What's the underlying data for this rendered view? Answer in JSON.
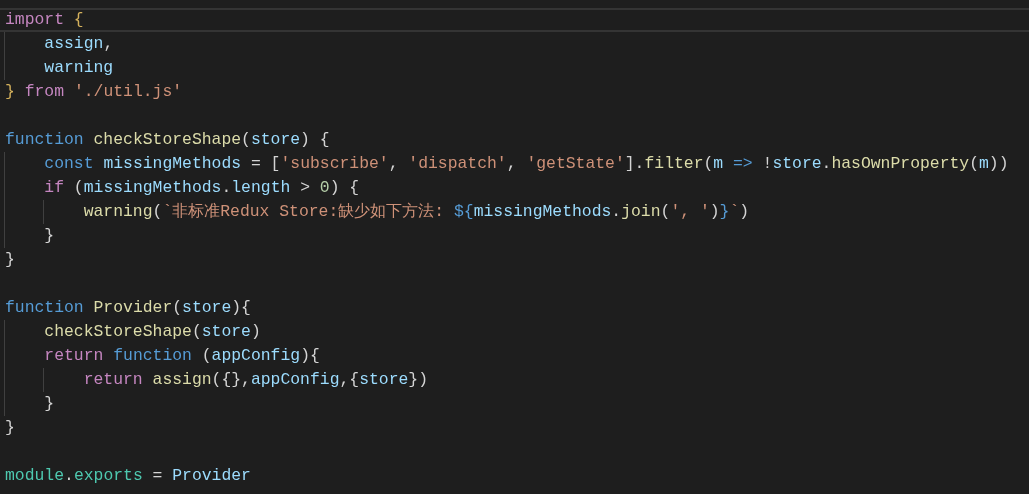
{
  "editor": {
    "lines": [
      {
        "kind": "code",
        "current": true,
        "tokens": [
          {
            "text": "import ",
            "kind": "keyword"
          },
          {
            "text": "{",
            "kind": "brace"
          }
        ]
      },
      {
        "kind": "code",
        "current": false,
        "tokens": [
          {
            "text": "    assign",
            "kind": "variable"
          },
          {
            "text": ",",
            "kind": "plain"
          }
        ]
      },
      {
        "kind": "code",
        "current": false,
        "tokens": [
          {
            "text": "    warning",
            "kind": "variable"
          }
        ]
      },
      {
        "kind": "code",
        "current": false,
        "tokens": [
          {
            "text": "} ",
            "kind": "brace"
          },
          {
            "text": "from ",
            "kind": "keyword"
          },
          {
            "text": "'./util.js'",
            "kind": "string"
          }
        ]
      },
      {
        "kind": "blank",
        "current": false
      },
      {
        "kind": "code",
        "current": false,
        "tokens": [
          {
            "text": "function ",
            "kind": "storage"
          },
          {
            "text": "checkStoreShape",
            "kind": "func"
          },
          {
            "text": "(",
            "kind": "plain"
          },
          {
            "text": "store",
            "kind": "variable"
          },
          {
            "text": ") {",
            "kind": "plain"
          }
        ]
      },
      {
        "kind": "code",
        "current": false,
        "tokens": [
          {
            "text": "    const ",
            "kind": "storage"
          },
          {
            "text": "missingMethods",
            "kind": "variable"
          },
          {
            "text": " = [",
            "kind": "plain"
          },
          {
            "text": "'subscribe'",
            "kind": "string"
          },
          {
            "text": ", ",
            "kind": "plain"
          },
          {
            "text": "'dispatch'",
            "kind": "string"
          },
          {
            "text": ", ",
            "kind": "plain"
          },
          {
            "text": "'getState'",
            "kind": "string"
          },
          {
            "text": "].",
            "kind": "plain"
          },
          {
            "text": "filter",
            "kind": "func"
          },
          {
            "text": "(",
            "kind": "plain"
          },
          {
            "text": "m ",
            "kind": "variable"
          },
          {
            "text": "=>",
            "kind": "storage"
          },
          {
            "text": " !",
            "kind": "plain"
          },
          {
            "text": "store",
            "kind": "variable"
          },
          {
            "text": ".",
            "kind": "plain"
          },
          {
            "text": "hasOwnProperty",
            "kind": "func"
          },
          {
            "text": "(",
            "kind": "plain"
          },
          {
            "text": "m",
            "kind": "variable"
          },
          {
            "text": "))",
            "kind": "plain"
          }
        ]
      },
      {
        "kind": "code",
        "current": false,
        "tokens": [
          {
            "text": "    if",
            "kind": "keyword"
          },
          {
            "text": " (",
            "kind": "plain"
          },
          {
            "text": "missingMethods",
            "kind": "variable"
          },
          {
            "text": ".",
            "kind": "plain"
          },
          {
            "text": "length",
            "kind": "variable"
          },
          {
            "text": " > ",
            "kind": "plain"
          },
          {
            "text": "0",
            "kind": "number"
          },
          {
            "text": ") {",
            "kind": "plain"
          }
        ]
      },
      {
        "kind": "code",
        "current": false,
        "tokens": [
          {
            "text": "        warning",
            "kind": "func"
          },
          {
            "text": "(",
            "kind": "plain"
          },
          {
            "text": "`非标准Redux Store:缺少如下方法: ",
            "kind": "string"
          },
          {
            "text": "${",
            "kind": "storage"
          },
          {
            "text": "missingMethods",
            "kind": "variable"
          },
          {
            "text": ".",
            "kind": "plain"
          },
          {
            "text": "join",
            "kind": "func"
          },
          {
            "text": "(",
            "kind": "plain"
          },
          {
            "text": "', '",
            "kind": "string"
          },
          {
            "text": ")",
            "kind": "plain"
          },
          {
            "text": "}",
            "kind": "storage"
          },
          {
            "text": "`",
            "kind": "string"
          },
          {
            "text": ")",
            "kind": "plain"
          }
        ]
      },
      {
        "kind": "code",
        "current": false,
        "tokens": [
          {
            "text": "    }",
            "kind": "plain"
          }
        ]
      },
      {
        "kind": "code",
        "current": false,
        "tokens": [
          {
            "text": "}",
            "kind": "plain"
          }
        ]
      },
      {
        "kind": "blank",
        "current": false
      },
      {
        "kind": "code",
        "current": false,
        "tokens": [
          {
            "text": "function ",
            "kind": "storage"
          },
          {
            "text": "Provider",
            "kind": "func"
          },
          {
            "text": "(",
            "kind": "plain"
          },
          {
            "text": "store",
            "kind": "variable"
          },
          {
            "text": "){",
            "kind": "plain"
          }
        ]
      },
      {
        "kind": "code",
        "current": false,
        "tokens": [
          {
            "text": "    checkStoreShape",
            "kind": "func"
          },
          {
            "text": "(",
            "kind": "plain"
          },
          {
            "text": "store",
            "kind": "variable"
          },
          {
            "text": ")",
            "kind": "plain"
          }
        ]
      },
      {
        "kind": "code",
        "current": false,
        "tokens": [
          {
            "text": "    return ",
            "kind": "keyword"
          },
          {
            "text": "function",
            "kind": "storage"
          },
          {
            "text": " (",
            "kind": "plain"
          },
          {
            "text": "appConfig",
            "kind": "variable"
          },
          {
            "text": "){",
            "kind": "plain"
          }
        ]
      },
      {
        "kind": "code",
        "current": false,
        "tokens": [
          {
            "text": "        return ",
            "kind": "keyword"
          },
          {
            "text": "assign",
            "kind": "func"
          },
          {
            "text": "({},",
            "kind": "plain"
          },
          {
            "text": "appConfig",
            "kind": "variable"
          },
          {
            "text": ",{",
            "kind": "plain"
          },
          {
            "text": "store",
            "kind": "variable"
          },
          {
            "text": "})",
            "kind": "plain"
          }
        ]
      },
      {
        "kind": "code",
        "current": false,
        "tokens": [
          {
            "text": "    }",
            "kind": "plain"
          }
        ]
      },
      {
        "kind": "code",
        "current": false,
        "tokens": [
          {
            "text": "}",
            "kind": "plain"
          }
        ]
      },
      {
        "kind": "blank",
        "current": false
      },
      {
        "kind": "code",
        "current": false,
        "tokens": [
          {
            "text": "module",
            "kind": "type"
          },
          {
            "text": ".",
            "kind": "plain"
          },
          {
            "text": "exports",
            "kind": "type"
          },
          {
            "text": " = ",
            "kind": "plain"
          },
          {
            "text": "Provider",
            "kind": "variable"
          }
        ]
      }
    ]
  }
}
